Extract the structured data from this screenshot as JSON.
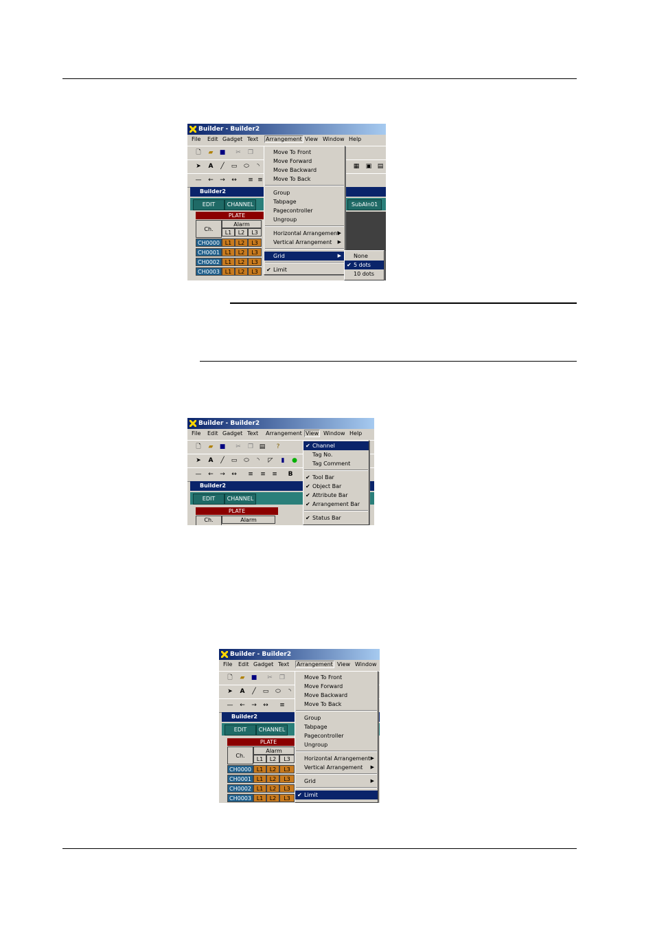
{
  "shot1": {
    "title": "Builder - Builder2",
    "menubar": [
      "File",
      "Edit",
      "Gadget",
      "Text",
      "Arrangement",
      "View",
      "Window",
      "Help"
    ],
    "child_title": "Builder2",
    "tabs": [
      "EDIT",
      "CHANNEL",
      "SubAIn01"
    ],
    "plate": "PLATE",
    "ch_header": "Ch.",
    "alarm_header": "Alarm",
    "levels": [
      "L1",
      "L2",
      "L3"
    ],
    "channels": [
      "CH0000",
      "CH0001",
      "CH0002",
      "CH0003"
    ],
    "arrangement_menu": [
      "Move To Front",
      "Move Forward",
      "Move Backward",
      "Move To Back",
      "Group",
      "Tabpage",
      "Pagecontroller",
      "Ungroup",
      "Horizontal Arrangement",
      "Vertical Arrangement",
      "Grid",
      "Limit"
    ],
    "grid_submenu": [
      "None",
      "5 dots",
      "10 dots"
    ]
  },
  "shot2": {
    "title": "Builder - Builder2",
    "menubar": [
      "File",
      "Edit",
      "Gadget",
      "Text",
      "Arrangement",
      "View",
      "Window",
      "Help"
    ],
    "child_title": "Builder2",
    "tabs": [
      "EDIT",
      "CHANNEL"
    ],
    "plate": "PLATE",
    "ch_header": "Ch.",
    "alarm_header": "Alarm",
    "view_menu": [
      "Channel",
      "Tag No.",
      "Tag Comment",
      "Tool Bar",
      "Object Bar",
      "Attribute Bar",
      "Arrangement Bar",
      "Status Bar"
    ]
  },
  "shot3": {
    "title": "Builder - Builder2",
    "menubar": [
      "File",
      "Edit",
      "Gadget",
      "Text",
      "Arrangement",
      "View",
      "Window"
    ],
    "child_title": "Builder2",
    "tabs": [
      "EDIT",
      "CHANNEL"
    ],
    "plate": "PLATE",
    "ch_header": "Ch.",
    "alarm_header": "Alarm",
    "levels": [
      "L1",
      "L2",
      "L3"
    ],
    "channels": [
      "CH0000",
      "CH0001",
      "CH0002",
      "CH0003"
    ],
    "arrangement_menu": [
      "Move To Front",
      "Move Forward",
      "Move Backward",
      "Move To Back",
      "Group",
      "Tabpage",
      "Pagecontroller",
      "Ungroup",
      "Horizontal Arrangement",
      "Vertical Arrangement",
      "Grid",
      "Limit"
    ]
  }
}
